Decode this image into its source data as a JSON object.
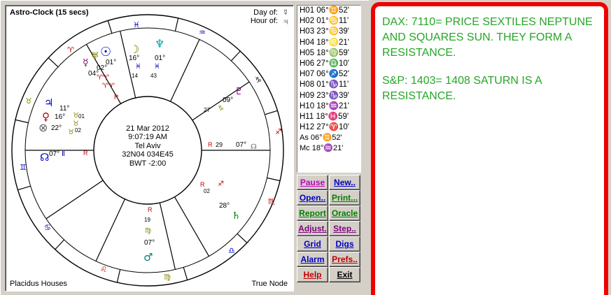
{
  "chart": {
    "title": "Astro-Clock (15 secs)",
    "day_of_label": "Day of:",
    "hour_of_label": "Hour of:",
    "day_ruler": "☿",
    "hour_ruler": "♃",
    "house_system": "Placidus Houses",
    "node_type": "True Node",
    "center": {
      "date": "21 Mar 2012",
      "time": "9:07:19 AM",
      "place": "Tel Aviv",
      "coords": "32N04 034E45",
      "timezone": "BWT -2:00"
    },
    "cusp_labels": {
      "asc_deg": "07°",
      "asc_min": "Π",
      "desc_deg": "07°",
      "desc_r": "R",
      "desc_29": "29"
    }
  },
  "cusps": [
    "H01  06°♊52'",
    "H02  01°♋11'",
    "H03  23°♋39'",
    "H04  18°♌21'",
    "H05  18°♍59'",
    "H06  27°♎10'",
    "H07  06°♐52'",
    "H08  01°♑11'",
    "H09  23°♑39'",
    "H10  18°♒21'",
    "H11  18°♓59'",
    "H12  27°♈10'",
    "As  06°♊52'",
    "Mc  18°♒21'"
  ],
  "buttons": [
    {
      "label": "Pause",
      "color": "#c000c0"
    },
    {
      "label": "New..",
      "color": "#0000c0"
    },
    {
      "label": "Open..",
      "color": "#0000c0"
    },
    {
      "label": "Print...",
      "color": "#008000"
    },
    {
      "label": "Report",
      "color": "#008000"
    },
    {
      "label": "Oracle",
      "color": "#008000"
    },
    {
      "label": "Adjust.",
      "color": "#800080"
    },
    {
      "label": "Step..",
      "color": "#800080"
    },
    {
      "label": "Grid",
      "color": "#0000c0"
    },
    {
      "label": "Digs",
      "color": "#0000c0"
    },
    {
      "label": "Alarm",
      "color": "#0000c0"
    },
    {
      "label": "Prefs..",
      "color": "#c00000"
    },
    {
      "label": "Help",
      "color": "#c00000"
    },
    {
      "label": "Exit",
      "color": "#000000"
    }
  ],
  "note": {
    "para1": "DAX: 7110= PRICE SEXTILES NEPTUNE AND SQUARES SUN. THEY FORM A RESISTANCE.",
    "para2": "S&P: 1403= 1408 SATURN IS A RESISTANCE.",
    "text_color": "#27a627",
    "border_color": "#ee0000"
  },
  "planets": [
    {
      "name": "sun",
      "glyph": "☉",
      "color": "#0000c0",
      "deg": "01°"
    },
    {
      "name": "moon",
      "glyph": "☽",
      "color": "#808000",
      "deg": "16°",
      "min": "14"
    },
    {
      "name": "neptune",
      "glyph": "♆",
      "color": "#00a0a0",
      "deg": "01°",
      "min": "43"
    },
    {
      "name": "pluto",
      "glyph": "♇",
      "color": "#800080",
      "deg": "09°",
      "min": "27"
    },
    {
      "name": "saturn",
      "glyph": "♄",
      "color": "#008000",
      "deg": "28°",
      "min": "02",
      "retro": "R"
    },
    {
      "name": "mars",
      "glyph": "♂",
      "color": "#008080",
      "deg": "07°",
      "min": "19",
      "retro": "R"
    },
    {
      "name": "jupiter",
      "glyph": "♃",
      "color": "#0000c0",
      "deg": "11°"
    },
    {
      "name": "venus",
      "glyph": "♀",
      "color": "#c00000",
      "deg": "16°",
      "min": "01"
    },
    {
      "name": "part-fortune",
      "glyph": "⊗",
      "color": "#606060",
      "deg": "22°",
      "min": "02"
    },
    {
      "name": "node",
      "glyph": "☊",
      "color": "#0000c0",
      "deg": "07°",
      "retro": "R"
    }
  ]
}
